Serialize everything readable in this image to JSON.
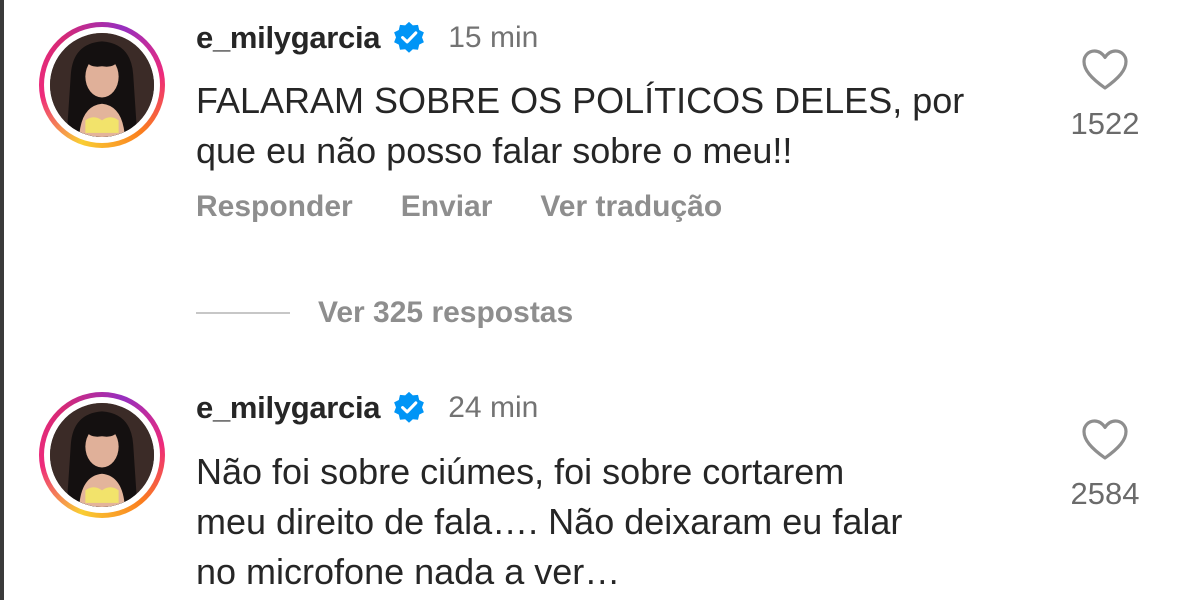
{
  "comments": [
    {
      "username": "e_milygarcia",
      "time": "15 min",
      "text_lines": [
        "FALARAM SOBRE OS POLÍTICOS DELES, por",
        "que eu não posso falar sobre o meu!!"
      ],
      "likes": "1522",
      "actions": [
        "Responder",
        "Enviar",
        "Ver tradução"
      ],
      "replies_label": "Ver 325 respostas"
    },
    {
      "username": "e_milygarcia",
      "time": "24 min",
      "text_lines": [
        "Não foi sobre ciúmes, foi sobre cortarem",
        "meu direito de fala…. Não deixaram eu falar",
        "no microfone nada a ver…"
      ],
      "likes": "2584"
    }
  ],
  "icons": {
    "verified": "verified-badge-icon",
    "like": "heart-outline-icon"
  },
  "colors": {
    "verified_blue": "#0095f6",
    "muted_text": "#8e8e8e",
    "primary_text": "#262626"
  }
}
